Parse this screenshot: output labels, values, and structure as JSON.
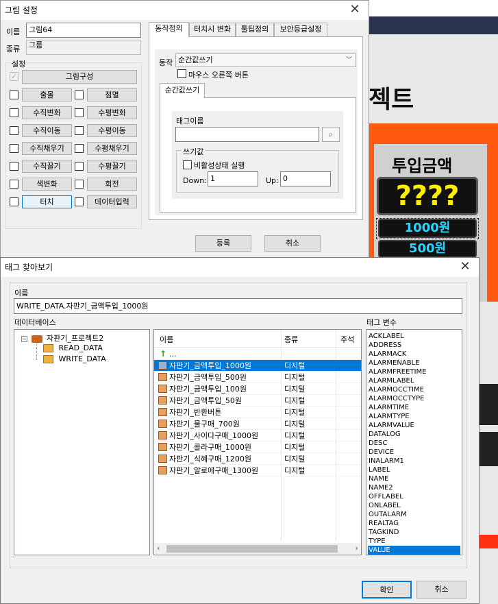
{
  "bg": {
    "project_title": "젝트",
    "input_amount": "투입금액",
    "display": "????",
    "btn_1000": "1000원",
    "btn_500": "500원"
  },
  "picture_dialog": {
    "title": "그림 설정",
    "name_label": "이름",
    "name_value": "그림64",
    "kind_label": "종류",
    "kind_value": "그룹",
    "settings_label": "설정",
    "compose_button": "그림구성",
    "options": [
      {
        "left": "출몰",
        "right": "점멸"
      },
      {
        "left": "수직변화",
        "right": "수평변화"
      },
      {
        "left": "수직이동",
        "right": "수평이동"
      },
      {
        "left": "수직채우기",
        "right": "수평채우기"
      },
      {
        "left": "수직끌기",
        "right": "수평끌기"
      },
      {
        "left": "색변화",
        "right": "회전"
      },
      {
        "left": "터치",
        "right": "데이터입력"
      }
    ],
    "tabs": [
      "동작정의",
      "터치시 변화",
      "툴팁정의",
      "보안등급설정"
    ],
    "action_label": "동작",
    "action_value": "순간값쓰기",
    "mouse_right": "마우스 오른쪽 버튼",
    "subtab": "순간값쓰기",
    "tag_name_label": "태그이름",
    "write_value_label": "쓰기값",
    "inactive_run": "비활성상태 실행",
    "down_label": "Down:",
    "down_value": "1",
    "up_label": "Up:",
    "up_value": "0",
    "register_button": "등록",
    "cancel_button": "취소"
  },
  "tag_dialog": {
    "title": "태그 찾아보기",
    "name_label": "이름",
    "name_value": "WRITE_DATA.자판기_금액투입_1000원",
    "db_label": "데이터베이스",
    "tree": {
      "root": "자판기_프로젝트2",
      "children": [
        "READ_DATA",
        "WRITE_DATA"
      ]
    },
    "columns": [
      "이름",
      "종류",
      "주석"
    ],
    "up_item": "...",
    "rows": [
      {
        "name": "자판기_금액투입_1000원",
        "kind": "디지털"
      },
      {
        "name": "자판기_금액투입_500원",
        "kind": "디지털"
      },
      {
        "name": "자판기_금액투입_100원",
        "kind": "디지털"
      },
      {
        "name": "자판기_금액투입_50원",
        "kind": "디지털"
      },
      {
        "name": "자판기_반환버튼",
        "kind": "디지털"
      },
      {
        "name": "자판기_물구매_700원",
        "kind": "디지털"
      },
      {
        "name": "자판기_사이다구매_1000원",
        "kind": "디지털"
      },
      {
        "name": "자판기_콜라구매_1000원",
        "kind": "디지털"
      },
      {
        "name": "자판기_식혜구매_1200원",
        "kind": "디지털"
      },
      {
        "name": "자판기_알로에구매_1300원",
        "kind": "디지털"
      }
    ],
    "var_label": "태그 변수",
    "variables": [
      "ACKLABEL",
      "ADDRESS",
      "ALARMACK",
      "ALARMENABLE",
      "ALARMFREETIME",
      "ALARMLABEL",
      "ALARMOCCTIME",
      "ALARMOCCTYPE",
      "ALARMTIME",
      "ALARMTYPE",
      "ALARMVALUE",
      "DATALOG",
      "DESC",
      "DEVICE",
      "INALARM1",
      "LABEL",
      "NAME",
      "NAME2",
      "OFFLABEL",
      "ONLABEL",
      "OUTALARM",
      "REALTAG",
      "TAGKIND",
      "TYPE",
      "VALUE"
    ],
    "ok_button": "확인",
    "cancel_button": "취소"
  }
}
